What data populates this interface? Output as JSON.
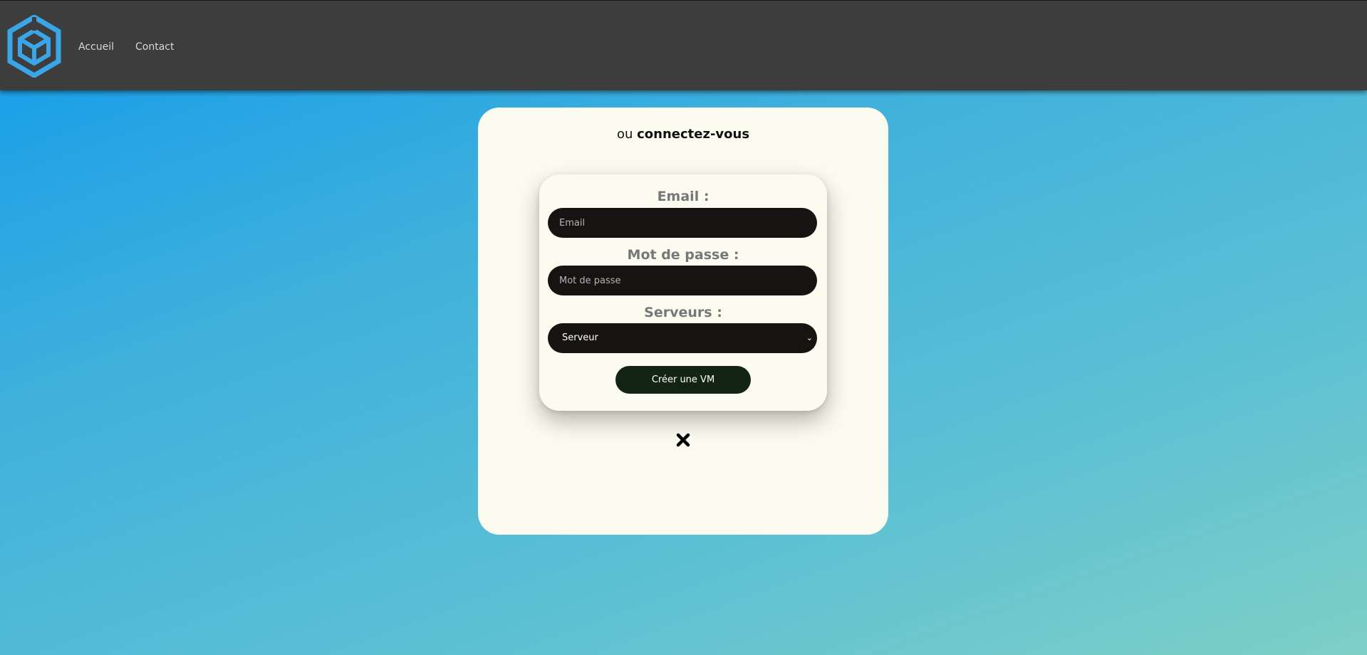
{
  "nav": {
    "logo_icon": "hexagon-cube-logo",
    "links": [
      "Accueil",
      "Contact"
    ]
  },
  "card": {
    "title_prefix": "ou ",
    "title_main": "connectez-vous",
    "form": {
      "email_label": "Email :",
      "email_placeholder": "Email",
      "password_label": "Mot de passe :",
      "password_placeholder": "Mot de passe",
      "server_label": "Serveurs :",
      "server_selected": "Serveur",
      "submit_label": "Créer une VM"
    },
    "close_icon": "close-icon"
  },
  "colors": {
    "navbar": "#3d3d3d",
    "card": "#fbfbf0",
    "field": "#161412",
    "button": "#132512",
    "logo": "#3aa6e8"
  }
}
